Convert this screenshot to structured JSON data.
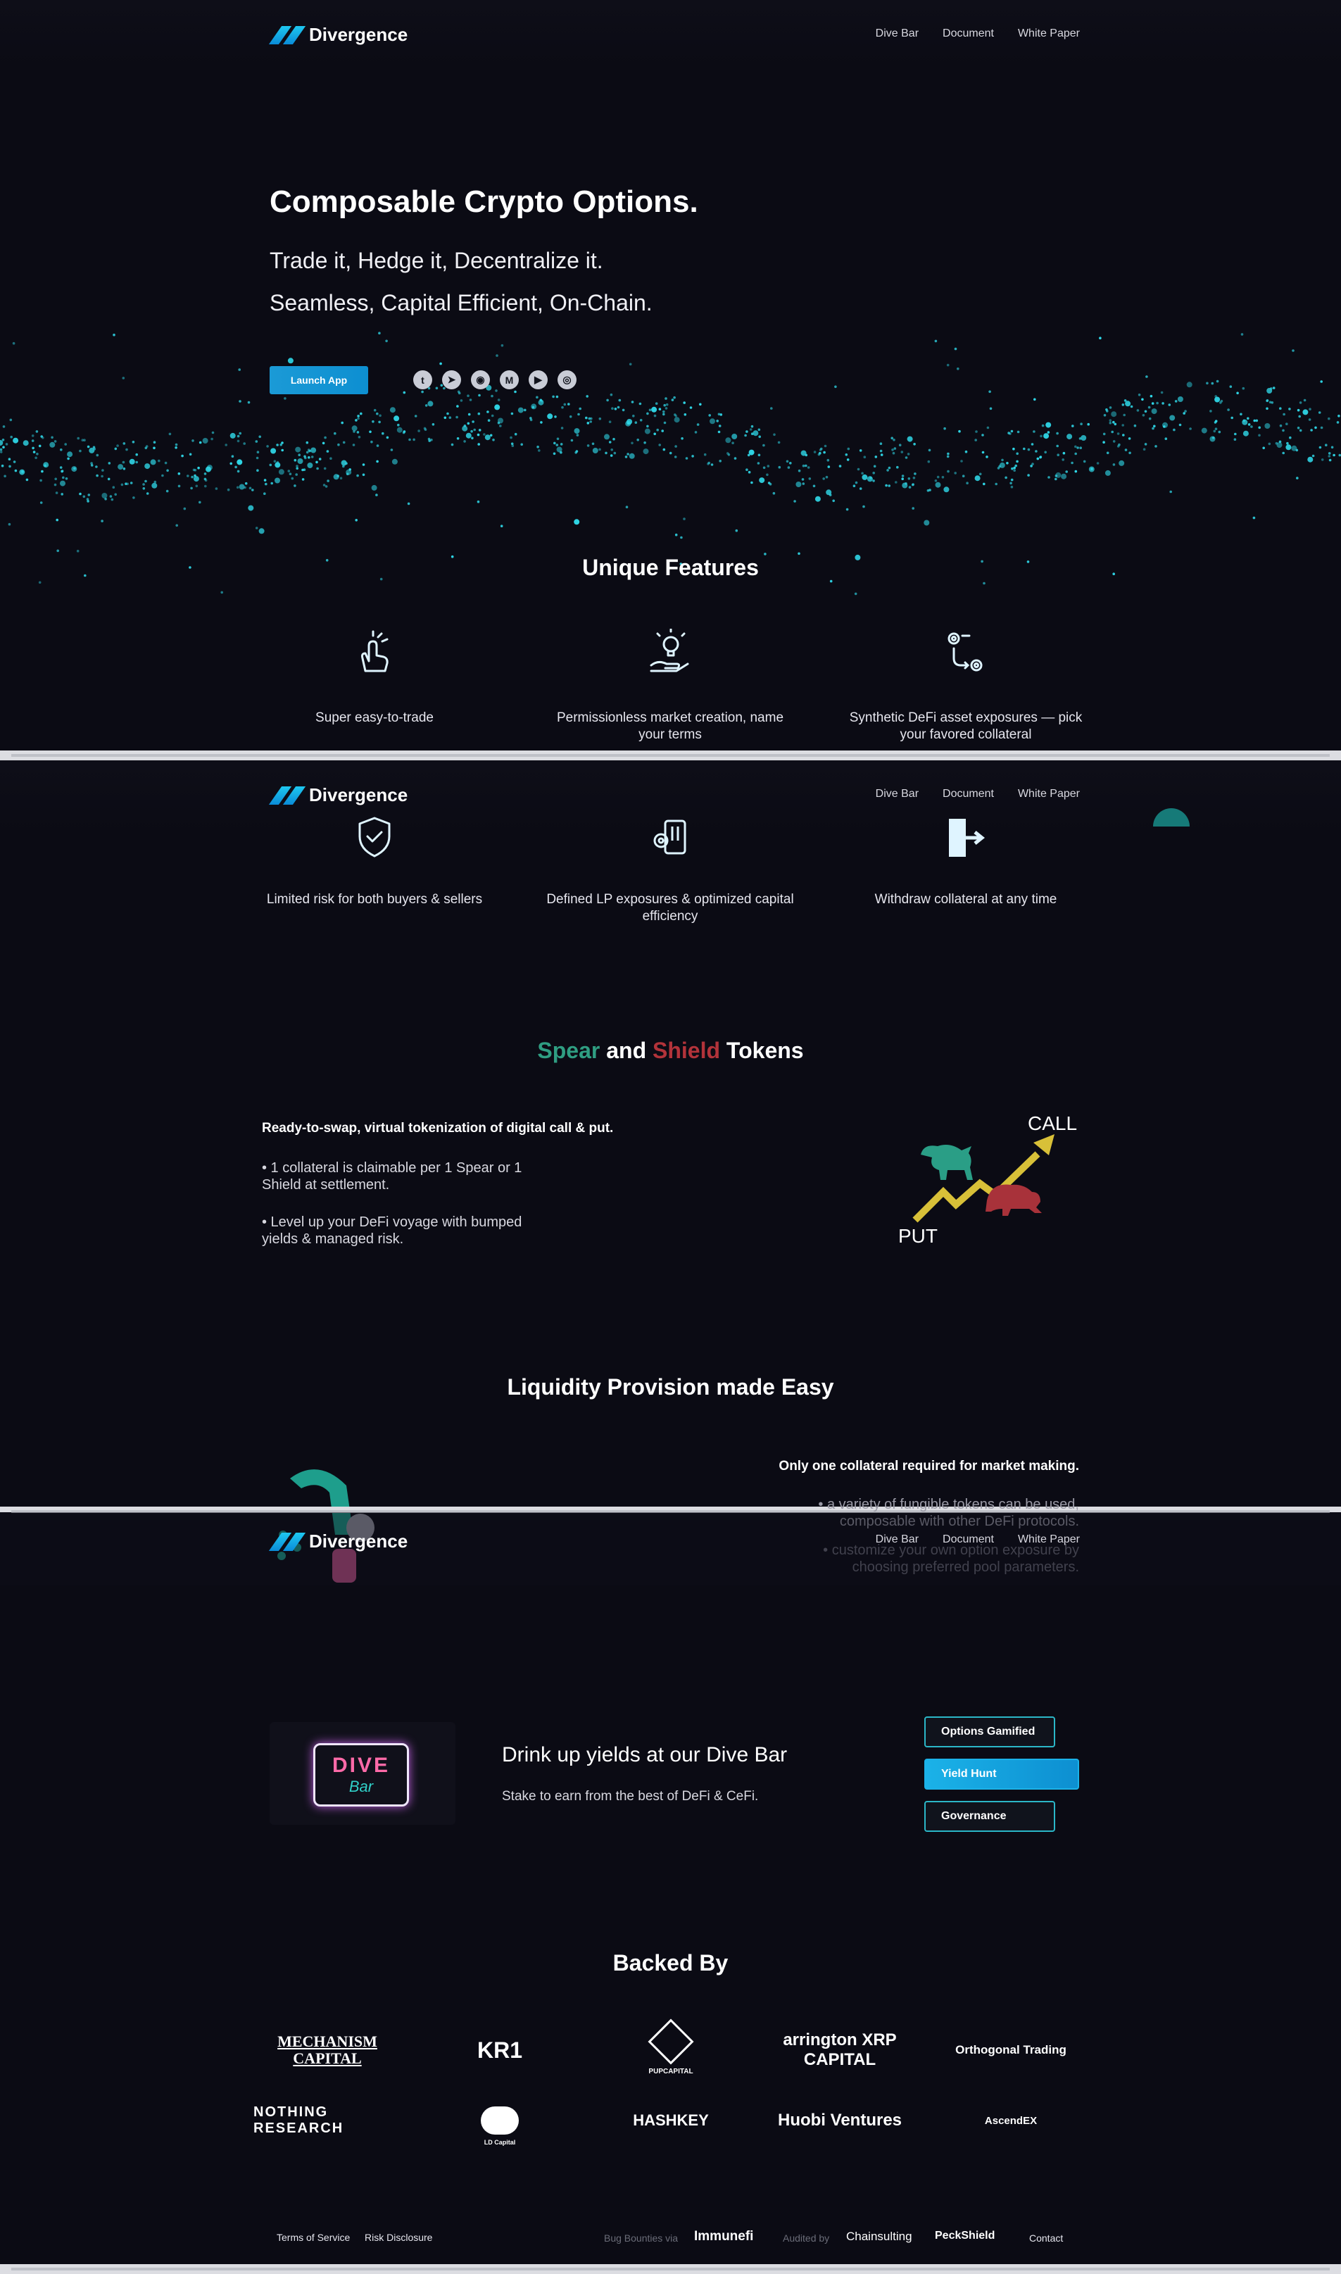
{
  "brand": {
    "name": "Divergence"
  },
  "nav": {
    "items": [
      "Dive Bar",
      "Document",
      "White Paper"
    ]
  },
  "hero": {
    "title": "Composable Crypto Options.",
    "line1": "Trade it, Hedge it, Decentralize it.",
    "line2": "Seamless, Capital Efficient, On-Chain.",
    "cta": "Launch App",
    "social_icons": [
      "twitter-icon",
      "telegram-icon",
      "discord-icon",
      "medium-icon",
      "youtube-icon",
      "github-icon"
    ]
  },
  "features": {
    "title": "Unique Features",
    "items": [
      {
        "icon": "hand-tap-icon",
        "label": "Super easy-to-trade"
      },
      {
        "icon": "lightbulb-hand-icon",
        "label": "Permissionless market creation, name your terms"
      },
      {
        "icon": "exchange-icon",
        "label": "Synthetic DeFi asset exposures — pick your favored collateral"
      },
      {
        "icon": "shield-check-icon",
        "label": "Limited risk for both buyers & sellers"
      },
      {
        "icon": "pool-gear-icon",
        "label": "Defined LP exposures & optimized capital efficiency"
      },
      {
        "icon": "withdraw-door-icon",
        "label": "Withdraw collateral at any time"
      }
    ]
  },
  "tokens": {
    "title_spear": "Spear",
    "title_and": "and",
    "title_shield": "Shield",
    "title_tokens": "Tokens",
    "spear_color": "#2f9e82",
    "shield_color": "#b2333a",
    "lead": "Ready-to-swap, virtual tokenization of digital call & put.",
    "bullet1": "• 1 collateral is claimable per 1 Spear or 1 Shield at settlement.",
    "bullet2": "• Level up your DeFi voyage with bumped yields & managed risk.",
    "call_label": "CALL",
    "put_label": "PUT"
  },
  "liquidity": {
    "title": "Liquidity Provision made Easy",
    "lead": "Only one collateral required for market making.",
    "bullet1": "• a variety of fungible tokens can be used, composable with other DeFi protocols.",
    "bullet2": "• customize your own option exposure by choosing preferred pool parameters."
  },
  "divebar": {
    "title": "Drink up yields at our Dive Bar",
    "subtitle": "Stake to earn from the best of DeFi & CeFi.",
    "sign_top": "DIVE",
    "sign_bottom": "Bar",
    "buttons": [
      "Options Gamified",
      "Yield Hunt",
      "Governance"
    ]
  },
  "backers": {
    "title": "Backed By",
    "row1": [
      "MECHANISM CAPITAL",
      "KR1",
      "PUPCAPITAL",
      "arrington XRP CAPITAL",
      "Orthogonal Trading"
    ],
    "row2": [
      "NOTHING RESEARCH",
      "LD Capital",
      "HASHKEY",
      "Huobi Ventures",
      "AscendEX"
    ]
  },
  "footer": {
    "terms": "Terms of Service",
    "risk": "Risk Disclosure",
    "bounty_label": "Bug Bounties via",
    "immunefi": "Immunefi",
    "audited_label": "Audited by",
    "chainsulting": "Chainsulting",
    "peckshield": "PeckShield",
    "contact": "Contact"
  },
  "colors": {
    "accent": "#1ec8f0",
    "teal": "#2bb7c8",
    "background": "#0b0b14"
  }
}
